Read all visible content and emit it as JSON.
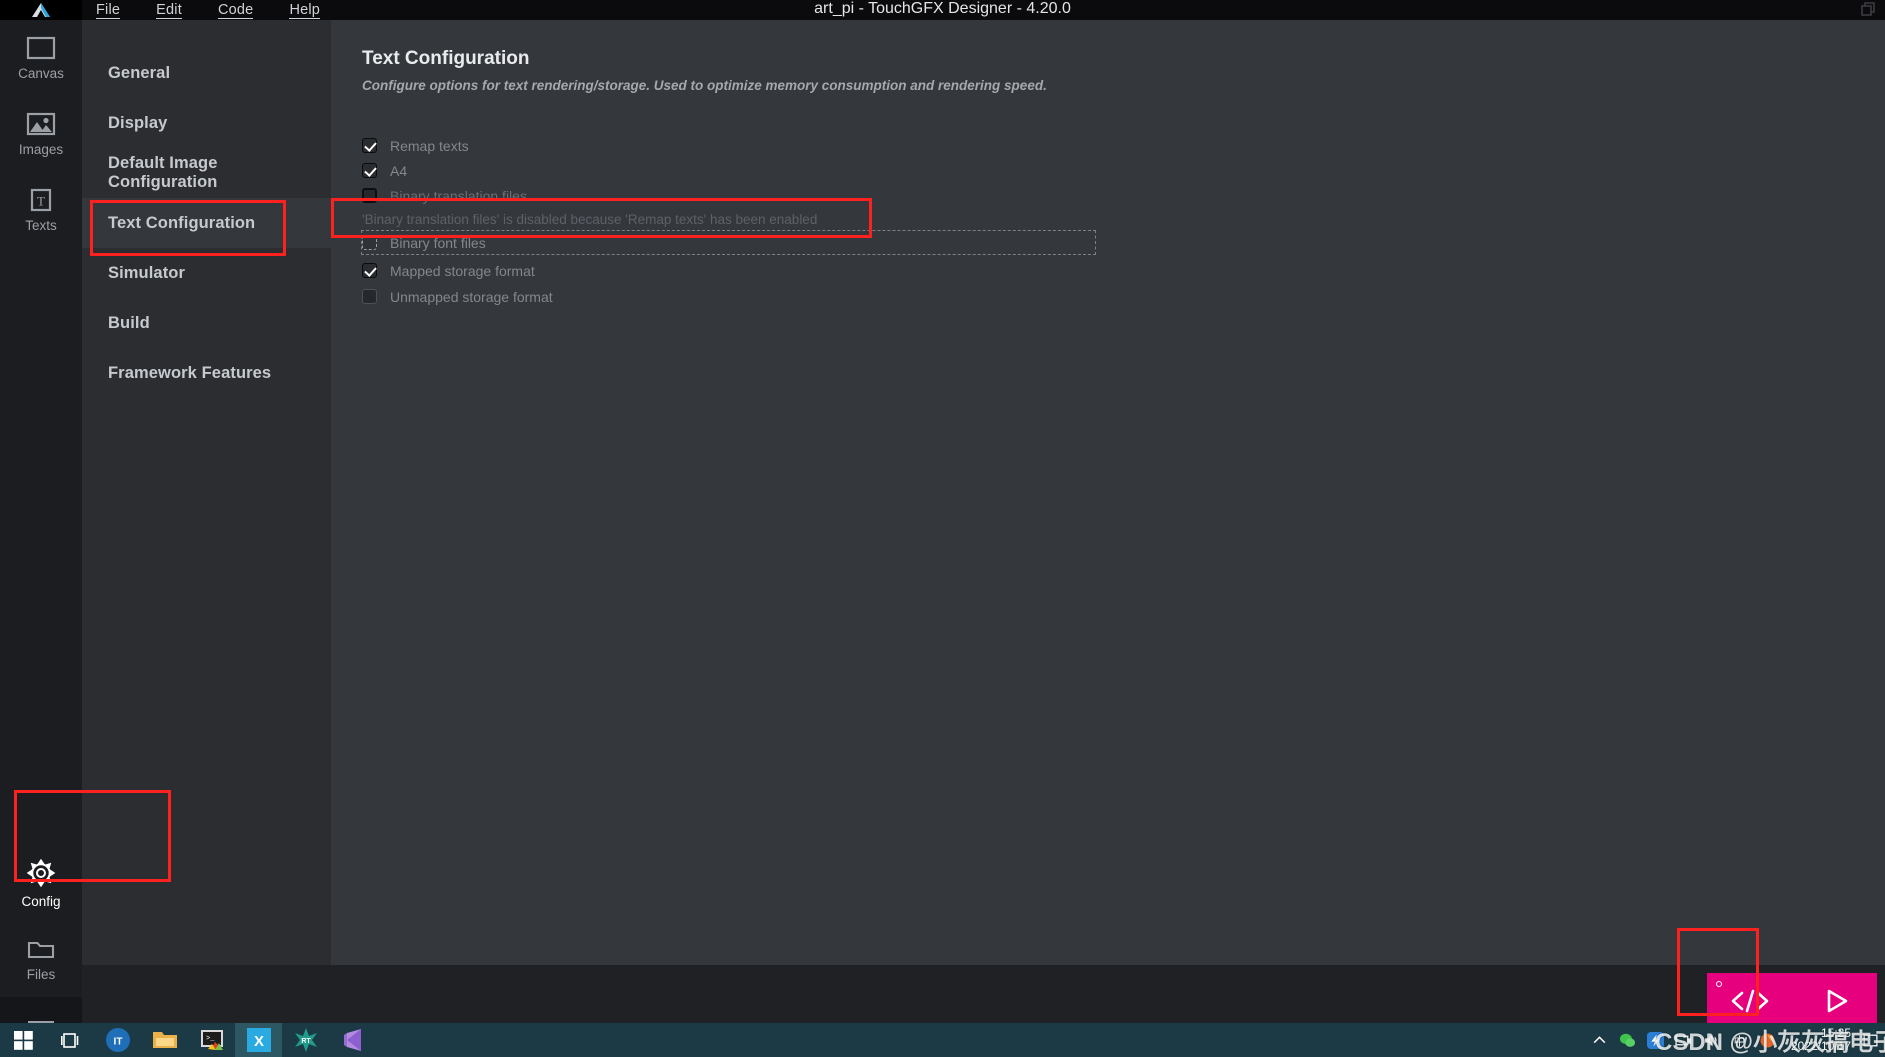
{
  "window": {
    "title": "art_pi - TouchGFX Designer - 4.20.0",
    "logo_icon": "touchgfx-logo-icon",
    "restore_icon": "restore-window-icon"
  },
  "menubar": {
    "items": [
      {
        "label": "File",
        "name": "menu-file"
      },
      {
        "label": "Edit",
        "name": "menu-edit"
      },
      {
        "label": "Code",
        "name": "menu-code"
      },
      {
        "label": "Help",
        "name": "menu-help"
      }
    ]
  },
  "rail": {
    "items": [
      {
        "label": "Canvas",
        "icon": "canvas-icon"
      },
      {
        "label": "Images",
        "icon": "images-icon"
      },
      {
        "label": "Texts",
        "icon": "texts-icon"
      }
    ],
    "bottom_items": [
      {
        "label": "Config",
        "icon": "gear-icon"
      },
      {
        "label": "Files",
        "icon": "folder-icon"
      }
    ],
    "hamburger_icon": "hamburger-icon"
  },
  "settings_nav": {
    "items": [
      {
        "label": "General"
      },
      {
        "label": "Display"
      },
      {
        "label": "Default Image Configuration"
      },
      {
        "label": "Text Configuration"
      },
      {
        "label": "Simulator"
      },
      {
        "label": "Build"
      },
      {
        "label": "Framework Features"
      }
    ],
    "selected": "Text Configuration"
  },
  "panel": {
    "title": "Text Configuration",
    "subtitle": "Configure options for text rendering/storage. Used to optimize memory consumption and rendering speed.",
    "options": [
      {
        "label": "Remap texts",
        "state": "checked"
      },
      {
        "label": "A4",
        "state": "checked"
      },
      {
        "label": "Binary translation files",
        "state": "disabled-unchecked"
      },
      {
        "label": "Binary font files",
        "state": "focused-unchecked"
      },
      {
        "label": "Mapped storage format",
        "state": "checked"
      },
      {
        "label": "Unmapped storage format",
        "state": "unchecked"
      }
    ],
    "note": "'Binary translation files' is disabled because 'Remap texts' has been enabled"
  },
  "bottombar": {
    "buttons": [
      {
        "name": "generate-code-button",
        "icon": "code-brackets-icon"
      },
      {
        "name": "run-simulator-button",
        "icon": "play-triangle-icon"
      }
    ],
    "accent_color": "#e6007e"
  },
  "taskbar": {
    "icons": [
      {
        "name": "windows-start-icon"
      },
      {
        "name": "task-view-icon"
      },
      {
        "name": "it-app-icon",
        "label": "IT"
      },
      {
        "name": "file-explorer-icon"
      },
      {
        "name": "terminal-app-icon"
      },
      {
        "name": "xshell-app-icon",
        "label": "X"
      },
      {
        "name": "rt-thread-app-icon",
        "label": "RT"
      },
      {
        "name": "visual-studio-icon"
      }
    ],
    "tray": {
      "chevron_icon": "show-hidden-icons-icon",
      "wechat_icon": "wechat-icon",
      "thunder_icon": "thunder-icon",
      "network_icon": "network-icon",
      "volume_icon": "volume-icon",
      "ime_icon": "ime-icon",
      "firefox_icon": "firefox-icon",
      "time": "15:25",
      "date": "2022/10/17",
      "notifications_icon": "notifications-icon"
    }
  },
  "watermark": {
    "text": "CSDN @小灰灰搞电子"
  },
  "annotations": {
    "boxes": [
      {
        "name": "annotation-text-configuration"
      },
      {
        "name": "annotation-binary-font-files"
      },
      {
        "name": "annotation-config-rail"
      },
      {
        "name": "annotation-generate-code-button"
      }
    ],
    "color": "#ff2020"
  }
}
